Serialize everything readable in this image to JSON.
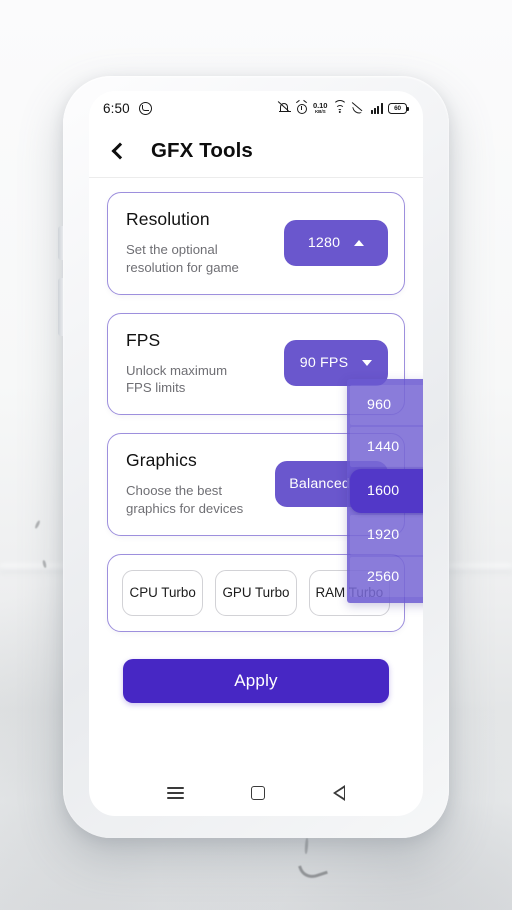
{
  "status_bar": {
    "time": "6:50",
    "whatsapp_icon": "whatsapp-icon",
    "bell_off_icon": "bell-off-icon",
    "alarm_icon": "alarm-icon",
    "data_speed_value": "0.10",
    "data_speed_unit": "KB/S",
    "wifi_icon": "wifi-icon",
    "call_mute_icon": "call-mute-icon",
    "signal_icon": "signal-bars-icon",
    "battery_level": "60"
  },
  "app_bar": {
    "back_icon": "back-chevron-icon",
    "title": "GFX Tools"
  },
  "cards": [
    {
      "title": "Resolution",
      "subtitle": "Set the optional\nresolution for game",
      "value": "1280",
      "caret": "caret-up-icon"
    },
    {
      "title": "FPS",
      "subtitle": "Unlock maximum\nFPS limits",
      "value": "90 FPS",
      "caret": "caret-down-icon"
    },
    {
      "title": "Graphics",
      "subtitle": "Choose the best\ngraphics for devices",
      "value": "Balanced",
      "caret": "caret-down-icon"
    }
  ],
  "dropdown": {
    "open": true,
    "selected": "1600",
    "options": [
      "960",
      "1440",
      "1600",
      "1920",
      "2560"
    ]
  },
  "turbo_buttons": [
    {
      "label": "CPU Turbo"
    },
    {
      "label": "GPU Turbo"
    },
    {
      "label": "RAM Turbo"
    }
  ],
  "apply": {
    "label": "Apply"
  },
  "nav_bar": {
    "recents_icon": "recents-menu-icon",
    "home_icon": "home-square-icon",
    "back_icon": "back-triangle-icon"
  },
  "colors": {
    "card_border": "#9d8fdd",
    "pill_purple": "#6a57cd",
    "apply_indigo": "#4727c4",
    "dropdown_selected": "#5238c8",
    "text_primary": "#111111",
    "text_secondary": "#6f6f74"
  }
}
